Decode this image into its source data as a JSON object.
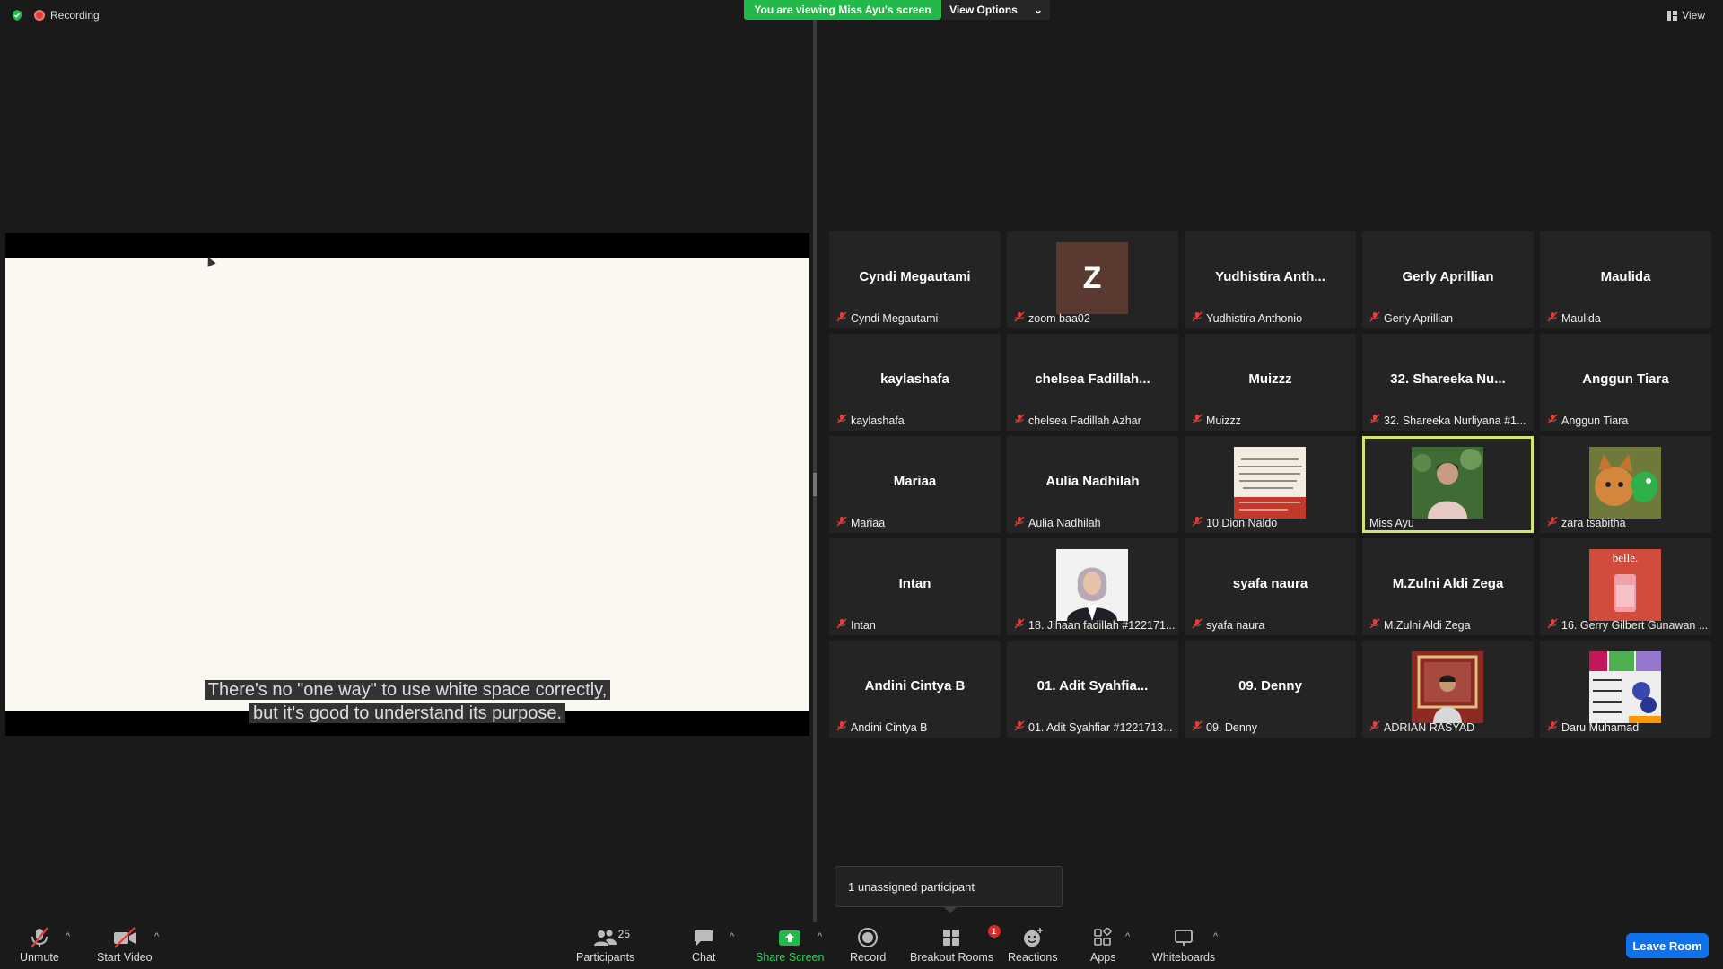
{
  "top": {
    "recording_label": "Recording",
    "viewing_banner": "You are viewing Miss Ayu's screen",
    "view_options_label": "View Options",
    "view_label": "View"
  },
  "share": {
    "caption_line1": "There's no \"one way\" to use white space correctly,",
    "caption_line2": "but it's good to understand its purpose."
  },
  "participants": [
    {
      "display": "Cyndi Megautami",
      "footer": "Cyndi Megautami",
      "muted": true
    },
    {
      "display": "Z",
      "footer": "zoom baa02",
      "muted": true,
      "avatar": "letter-z"
    },
    {
      "display": "Yudhistira  Anth...",
      "footer": "Yudhistira Anthonio",
      "muted": true
    },
    {
      "display": "Gerly Aprillian",
      "footer": "Gerly Aprillian",
      "muted": true
    },
    {
      "display": "Maulida",
      "footer": "Maulida",
      "muted": true
    },
    {
      "display": "kaylashafa",
      "footer": "kaylashafa",
      "muted": true
    },
    {
      "display": "chelsea  Fadillah...",
      "footer": "chelsea Fadillah Azhar",
      "muted": true
    },
    {
      "display": "Muizzz",
      "footer": "Muizzz",
      "muted": true
    },
    {
      "display": "32. Shareeka  Nu...",
      "footer": "32. Shareeka Nurliyana #1...",
      "muted": true
    },
    {
      "display": "Anggun Tiara",
      "footer": "Anggun Tiara",
      "muted": true
    },
    {
      "display": "Mariaa",
      "footer": "Mariaa",
      "muted": true
    },
    {
      "display": "Aulia Nadhilah",
      "footer": "Aulia Nadhilah",
      "muted": true
    },
    {
      "display": "",
      "footer": "10.Dion Naldo",
      "muted": true,
      "avatar": "photo-text-image"
    },
    {
      "display": "",
      "footer": "Miss Ayu",
      "muted": false,
      "avatar": "photo-woman",
      "active": true
    },
    {
      "display": "",
      "footer": "zara tsabitha",
      "muted": true,
      "avatar": "photo-cat"
    },
    {
      "display": "Intan",
      "footer": "Intan",
      "muted": true
    },
    {
      "display": "",
      "footer": "18. Jihaan fadillah #122171...",
      "muted": true,
      "avatar": "photo-hijab"
    },
    {
      "display": "syafa naura",
      "footer": "syafa naura",
      "muted": true
    },
    {
      "display": "M.Zulni Aldi Zega",
      "footer": "M.Zulni Aldi Zega",
      "muted": true
    },
    {
      "display": "",
      "footer": "16. Gerry Gilbert Gunawan ...",
      "muted": true,
      "avatar": "photo-product"
    },
    {
      "display": "Andini Cintya B",
      "footer": "Andini Cintya B",
      "muted": true
    },
    {
      "display": "01. Adit  Syahfia...",
      "footer": "01. Adit Syahfiar #1221713...",
      "muted": true
    },
    {
      "display": "09. Denny",
      "footer": "09. Denny",
      "muted": true
    },
    {
      "display": "",
      "footer": "ADRIAN RASYAD",
      "muted": true,
      "avatar": "photo-man"
    },
    {
      "display": "",
      "footer": "Daru Muhamad",
      "muted": true,
      "avatar": "photo-collage"
    }
  ],
  "avatar_texts": {
    "z_letter": "Z",
    "product_text": "belle."
  },
  "popup": {
    "unassigned": "1 unassigned participant"
  },
  "toolbar": {
    "unmute": "Unmute",
    "start_video": "Start Video",
    "participants": "Participants",
    "participant_count": "25",
    "chat": "Chat",
    "share_screen": "Share Screen",
    "record": "Record",
    "breakout_rooms": "Breakout Rooms",
    "breakout_badge": "1",
    "reactions": "Reactions",
    "apps": "Apps",
    "whiteboards": "Whiteboards",
    "leave_room": "Leave Room"
  },
  "colors": {
    "banner_green": "#23b84a",
    "active_outline": "#d5e36f",
    "leave_blue": "#0e72ed",
    "muted_red": "#e0403a"
  }
}
